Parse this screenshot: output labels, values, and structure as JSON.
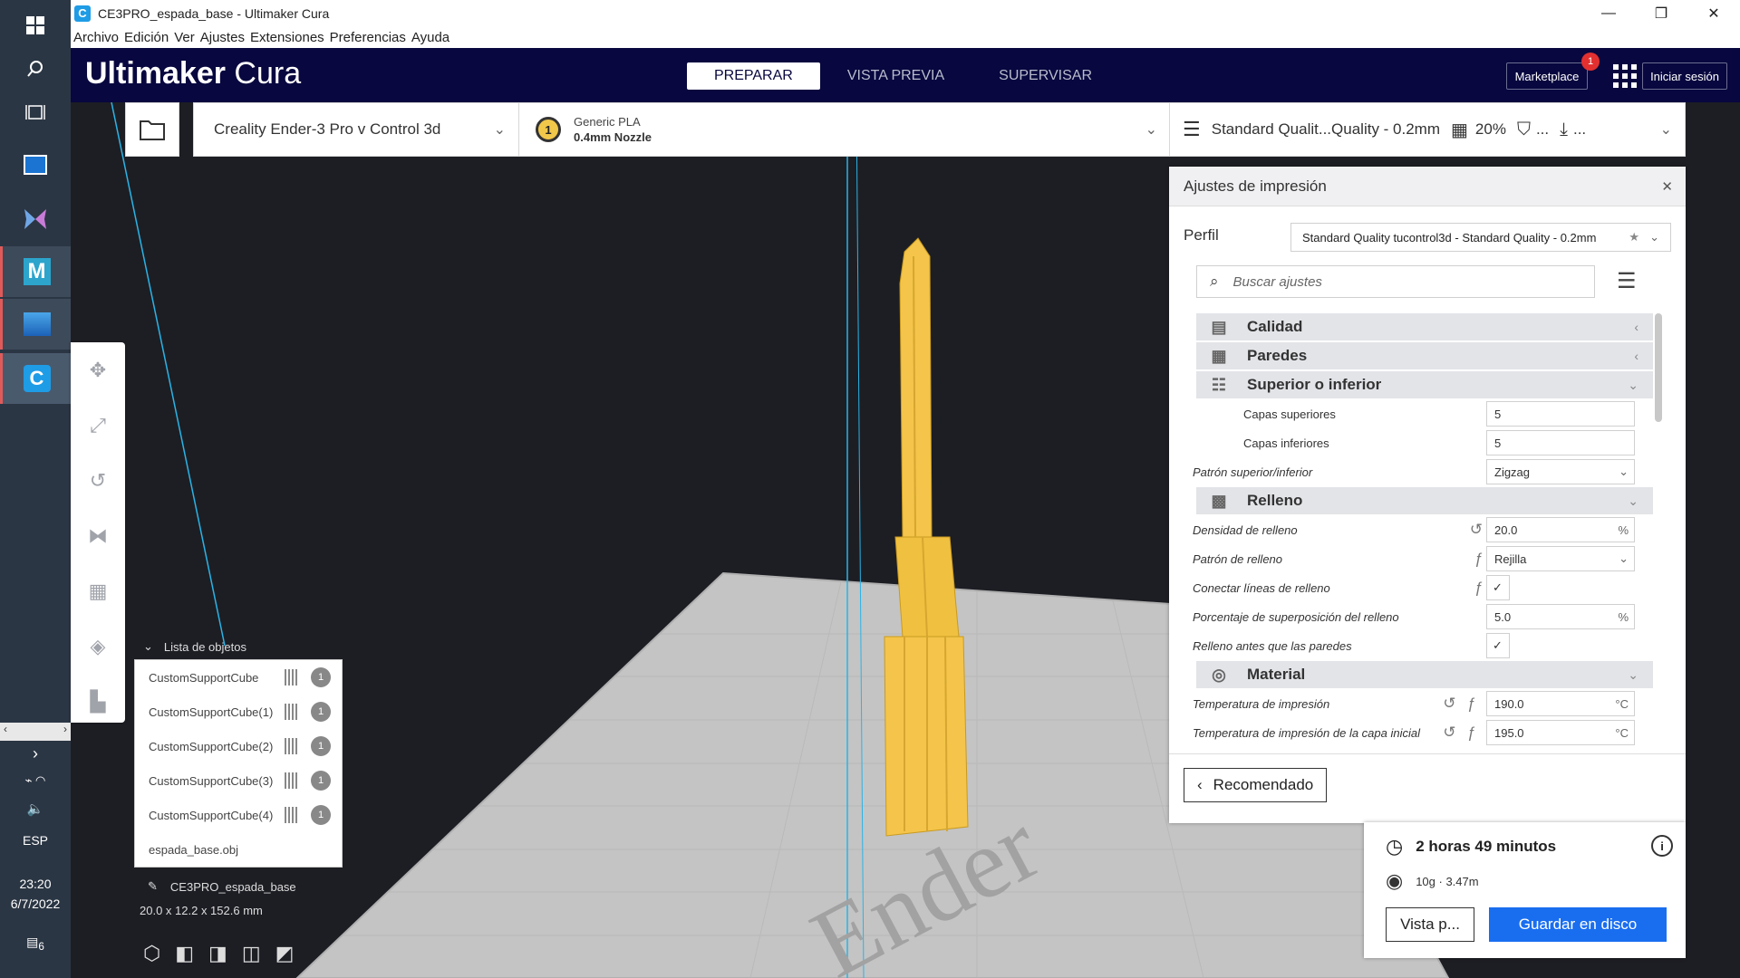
{
  "window": {
    "title": "CE3PRO_espada_base - Ultimaker Cura",
    "app_icon": "C"
  },
  "menu": [
    "Archivo",
    "Edición",
    "Ver",
    "Ajustes",
    "Extensiones",
    "Preferencias",
    "Ayuda"
  ],
  "header": {
    "logo_bold": "Ultimaker",
    "logo_light": " Cura",
    "stages": [
      "PREPARAR",
      "VISTA PREVIA",
      "SUPERVISAR"
    ],
    "active_stage": "PREPARAR",
    "marketplace": "Marketplace",
    "marketplace_badge": "1",
    "signin": "Iniciar sesión"
  },
  "printer": {
    "name": "Creality Ender-3 Pro v Control 3d",
    "extruder_number": "1",
    "material": "Generic PLA",
    "nozzle": "0.4mm Nozzle",
    "profile_summary": "Standard Qualit...Quality - 0.2mm",
    "infill": "20%",
    "more1": "...",
    "more2": "..."
  },
  "print_settings": {
    "title": "Ajustes de impresión",
    "profile_label": "Perfil",
    "profile_value": "Standard Quality tucontrol3d - Standard Quality - 0.2mm",
    "search_placeholder": "Buscar ajustes",
    "categories": [
      "Calidad",
      "Paredes",
      "Superior o inferior",
      "Relleno",
      "Material"
    ],
    "settings": [
      {
        "label": "Capas superiores",
        "value": "5"
      },
      {
        "label": "Capas inferiores",
        "value": "5"
      },
      {
        "label": "Patrón superior/inferior",
        "value": "Zigzag"
      },
      {
        "label": "Densidad de relleno",
        "value": "20.0",
        "unit": "%"
      },
      {
        "label": "Patrón de relleno",
        "value": "Rejilla"
      },
      {
        "label": "Conectar líneas de relleno",
        "value": "✓"
      },
      {
        "label": "Porcentaje de superposición del relleno",
        "value": "5.0",
        "unit": "%"
      },
      {
        "label": "Relleno antes que las paredes",
        "value": "✓"
      },
      {
        "label": "Temperatura de impresión",
        "value": "190.0",
        "unit": "°C"
      },
      {
        "label": "Temperatura de impresión de la capa inicial",
        "value": "195.0",
        "unit": "°C"
      }
    ],
    "recommended_button": "Recomendado"
  },
  "objects": {
    "header": "Lista de objetos",
    "items": [
      "CustomSupportCube",
      "CustomSupportCube(1)",
      "CustomSupportCube(2)",
      "CustomSupportCube(3)",
      "CustomSupportCube(4)",
      "espada_base.obj"
    ],
    "extruder_badge": "1",
    "job_name": "CE3PRO_espada_base",
    "dimensions": "20.0 x 12.2 x 152.6 mm"
  },
  "summary": {
    "time": "2 horas 49 minutos",
    "material": "10g · 3.47m",
    "preview_button": "Vista p...",
    "save_button": "Guardar en disco"
  },
  "buildplate_text": "Ender",
  "taskbar": {
    "lang": "ESP",
    "time": "23:20",
    "date": "6/7/2022",
    "notifications": "6"
  },
  "colors": {
    "header": "#08073f",
    "accent": "#196ef0",
    "model": "#f4c54a",
    "plate": "#c4c4c4"
  }
}
